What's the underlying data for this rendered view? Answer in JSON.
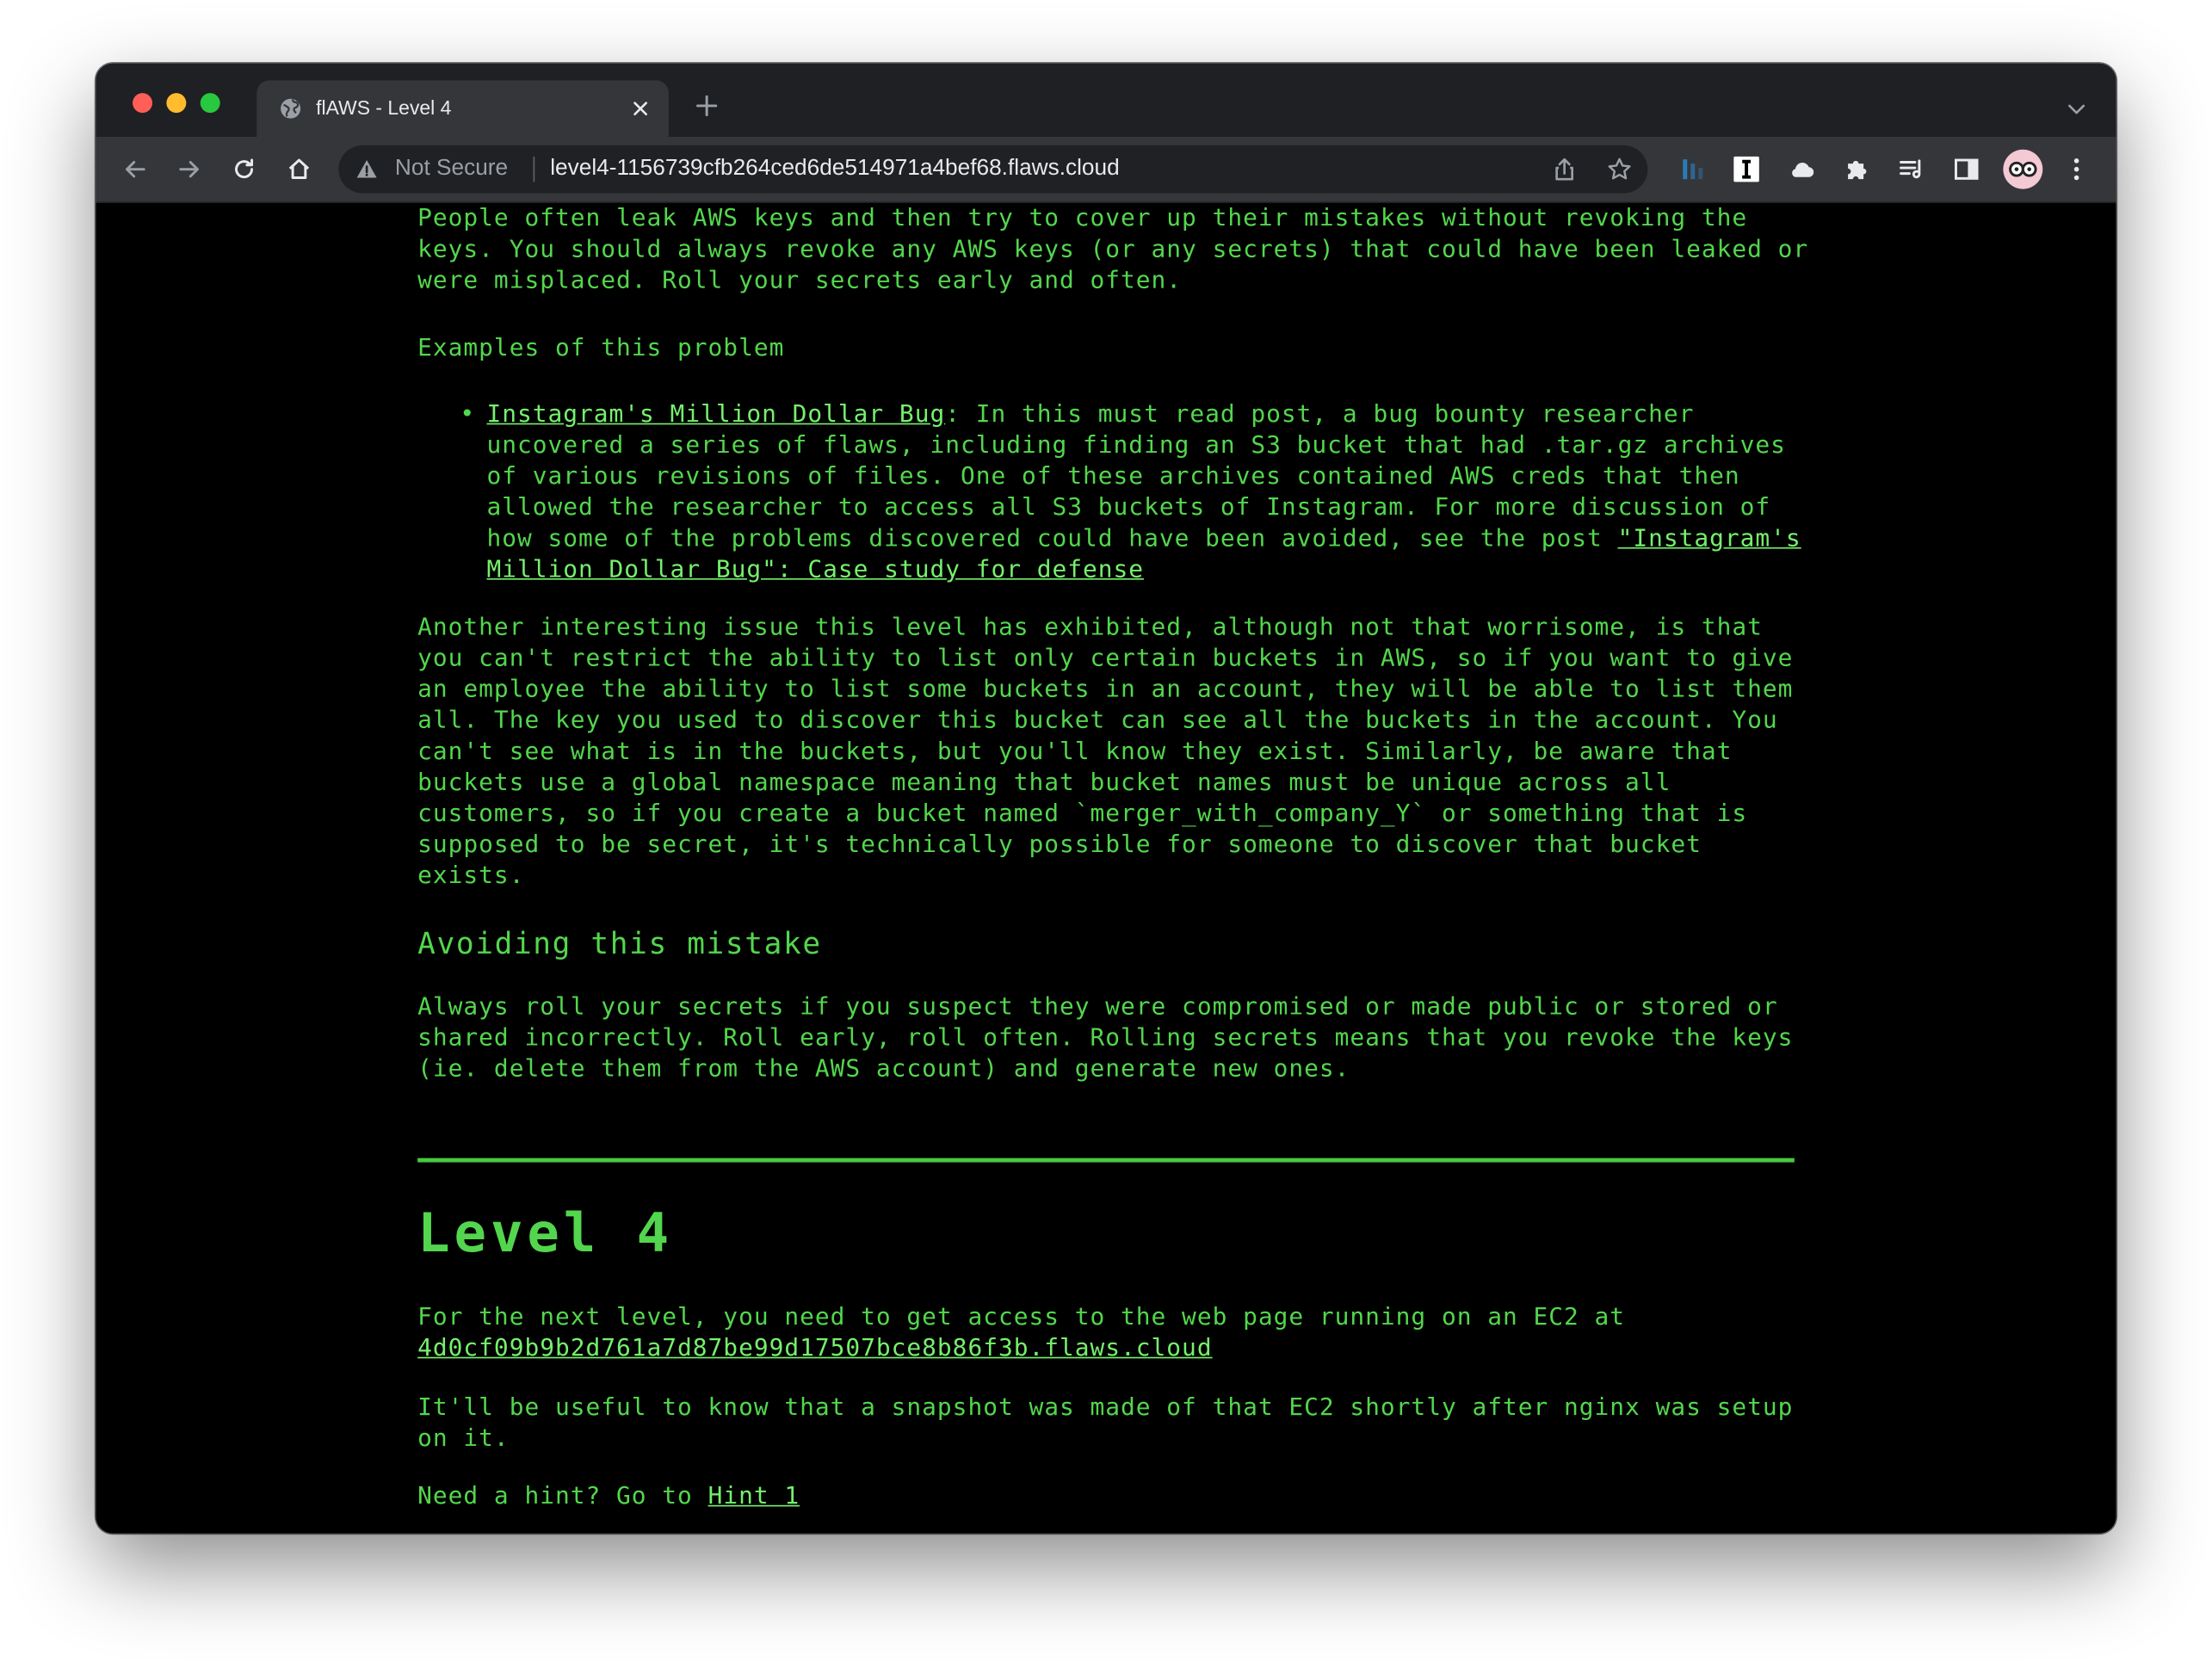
{
  "browser": {
    "tab_title": "flAWS - Level 4",
    "security_label": "Not Secure",
    "url": "level4-1156739cfb264ced6de514971a4bef68.flaws.cloud"
  },
  "page": {
    "intro_paragraph": "People often leak AWS keys and then try to cover up their mistakes without revoking the keys. You should always revoke any AWS keys (or any secrets) that could have been leaked or were misplaced. Roll your secrets early and often.",
    "examples_heading": "Examples of this problem",
    "example": {
      "link_text": "Instagram's Million Dollar Bug",
      "text_before_post_link": ": In this must read post, a bug bounty researcher uncovered a series of flaws, including finding an S3 bucket that had .tar.gz archives of various revisions of files. One of these archives contained AWS creds that then allowed the researcher to access all S3 buckets of Instagram. For more discussion of how some of the problems discovered could have been avoided, see the post ",
      "post_link_text": "\"Instagram's Million Dollar Bug\": Case study for defense"
    },
    "issue_paragraph": "Another interesting issue this level has exhibited, although not that worrisome, is that you can't restrict the ability to list only certain buckets in AWS, so if you want to give an employee the ability to list some buckets in an account, they will be able to list them all. The key you used to discover this bucket can see all the buckets in the account. You can't see what is in the buckets, but you'll know they exist. Similarly, be aware that buckets use a global namespace meaning that bucket names must be unique across all customers, so if you create a bucket named `merger_with_company_Y` or something that is supposed to be secret, it's technically possible for someone to discover that bucket exists.",
    "avoiding_heading": "Avoiding this mistake",
    "avoiding_paragraph": "Always roll your secrets if you suspect they were compromised or made public or stored or shared incorrectly. Roll early, roll often. Rolling secrets means that you revoke the keys (ie. delete them from the AWS account) and generate new ones.",
    "level_heading": "Level 4",
    "next_level_text": "For the next level, you need to get access to the web page running on an EC2 at",
    "next_level_link": "4d0cf09b9b2d761a7d87be99d17507bce8b86f3b.flaws.cloud",
    "snapshot_paragraph": "It'll be useful to know that a snapshot was made of that EC2 shortly after nginx was setup on it.",
    "hint_text": "Need a hint? Go to",
    "hint_link": "Hint 1"
  },
  "colors": {
    "page_background": "#000000",
    "text_green": "#53d64d",
    "link_green": "#76f06d",
    "browser_chrome": "#35363a"
  }
}
